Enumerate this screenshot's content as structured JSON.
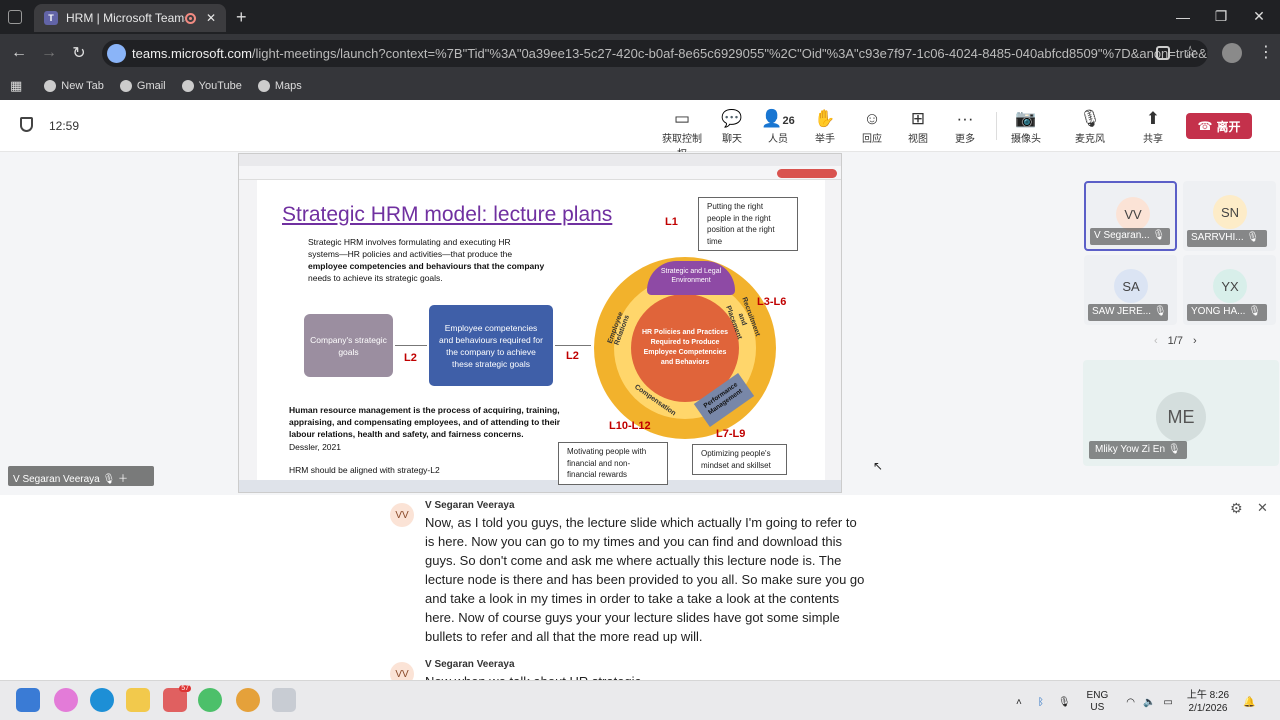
{
  "browser": {
    "tab_title": "HRM | Microsoft Teams",
    "url_host": "teams.microsoft.com",
    "url_path": "/light-meetings/launch?context=%7B\"Tid\"%3A\"0a39ee13-5c27-420c-b0af-8e65c6929055\"%2C\"Oid\"%3A\"c93e7f97-1c06-4024-8485-040abfcd8509\"%7D&anon=true&lightExp..."
  },
  "bookmarks": [
    "New Tab",
    "Gmail",
    "YouTube",
    "Maps"
  ],
  "meeting": {
    "timer": "12:59",
    "toolbar": [
      {
        "label": "获取控制权",
        "icon": "control-icon"
      },
      {
        "label": "聊天",
        "icon": "chat-icon"
      },
      {
        "label": "人员",
        "count": "26",
        "icon": "people-icon"
      },
      {
        "label": "举手",
        "icon": "raise-hand-icon"
      },
      {
        "label": "回应",
        "icon": "react-icon"
      },
      {
        "label": "视图",
        "icon": "view-icon"
      },
      {
        "label": "更多",
        "icon": "more-icon"
      },
      {
        "label": "摄像头",
        "icon": "camera-off-icon"
      },
      {
        "label": "麦克风",
        "icon": "mic-off-icon"
      },
      {
        "label": "共享",
        "icon": "share-icon"
      }
    ],
    "leave_label": "离开"
  },
  "participants": [
    {
      "initials": "VV",
      "name": "V Segaran...",
      "color": "#fbe3d6"
    },
    {
      "initials": "SN",
      "name": "SARRVHI...",
      "color": "#fdecc8"
    },
    {
      "initials": "SA",
      "name": "SAW JERE...",
      "color": "#dbe4f3"
    },
    {
      "initials": "YX",
      "name": "YONG HA...",
      "color": "#d8efea"
    }
  ],
  "pager": "1/7",
  "big_tile": {
    "initials": "ME",
    "name": "Mliky Yow Zi En"
  },
  "presenter_label": "V Segaran Veeraya",
  "slide": {
    "title": "Strategic HRM model: lecture plans",
    "intro": [
      "Strategic HRM involves formulating and executing HR",
      "systems—HR policies and activities—that produce the",
      "employee competencies and behaviours that the company",
      "needs to achieve its strategic goals."
    ],
    "box1": "Company's strategic goals",
    "box2": "Employee competencies and behaviours required for the company to achieve these strategic goals",
    "l2a": "L2",
    "l2b": "L2",
    "l1": "L1",
    "l36": "L3-L6",
    "l1012": "L10-L12",
    "l79": "L7-L9",
    "callout_top": [
      "Putting the right",
      "people in the right",
      "position at the right",
      "time"
    ],
    "callout_left": [
      "Motivating people with",
      "financial and non-",
      "financial rewards"
    ],
    "callout_right": [
      "Optimizing people's",
      "mindset and skillset"
    ],
    "wheel_center": [
      "HR Policies and Practices",
      "Required to Produce",
      "Employee Competencies",
      "and Behaviors"
    ],
    "seg_strategic": "Strategic and Legal Environment",
    "seg_recruit": "Recruitment and Placement",
    "seg_employee": "Employee Relations",
    "seg_comp": "Compensation",
    "seg_perf": "Performance Management",
    "def": [
      "Human resource management is the process of acquiring, training,",
      "appraising, and compensating employees, and of attending to their",
      "labour relations, health and safety, and fairness concerns."
    ],
    "cite": "Dessler, 2021",
    "footer": "HRM should be aligned with strategy-L2"
  },
  "captions": [
    {
      "initials": "VV",
      "speaker": "V Segaran Veeraya",
      "lines": [
        "Now, as I told you guys, the lecture slide which actually I'm going to refer to",
        "is here. Now you can go to my times and you can find and download this",
        "guys. So don't come and ask me where actually this lecture node is. The",
        "lecture node is there and has been provided to you all. So make sure you go",
        "and take a look in my times in order to take a take a look at the contents",
        "here. Now of course guys your your lecture slides have got some simple",
        "bullets to refer and all that the more read up will."
      ]
    },
    {
      "initials": "VV",
      "speaker": "V Segaran Veeraya",
      "lines": [
        "Now when we talk about HR strategic"
      ]
    }
  ],
  "taskbar": {
    "lang1": "ENG",
    "lang2": "US",
    "time": "上午 8:26",
    "date": "2/1/2026",
    "badge": "57"
  }
}
